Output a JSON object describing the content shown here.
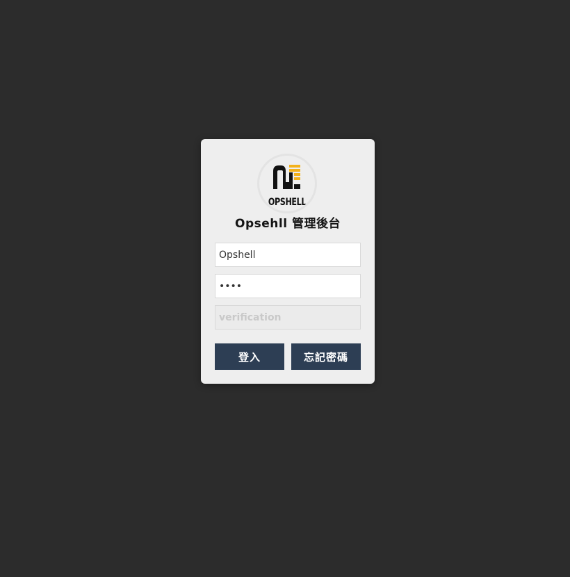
{
  "logo": {
    "icon": "opshell-logo",
    "wordmark": "OPSHELL",
    "colors": {
      "dark": "#111111",
      "accent": "#f3b21b"
    }
  },
  "title": "Opsehll 管理後台",
  "form": {
    "username_value": "Opshell",
    "password_value": "1234",
    "verification_placeholder": "verification"
  },
  "buttons": {
    "login_label": "登入",
    "forgot_label": "忘記密碼"
  },
  "colors": {
    "background": "#2c2c2c",
    "card": "#eeeeee",
    "button": "#2d3e54"
  }
}
